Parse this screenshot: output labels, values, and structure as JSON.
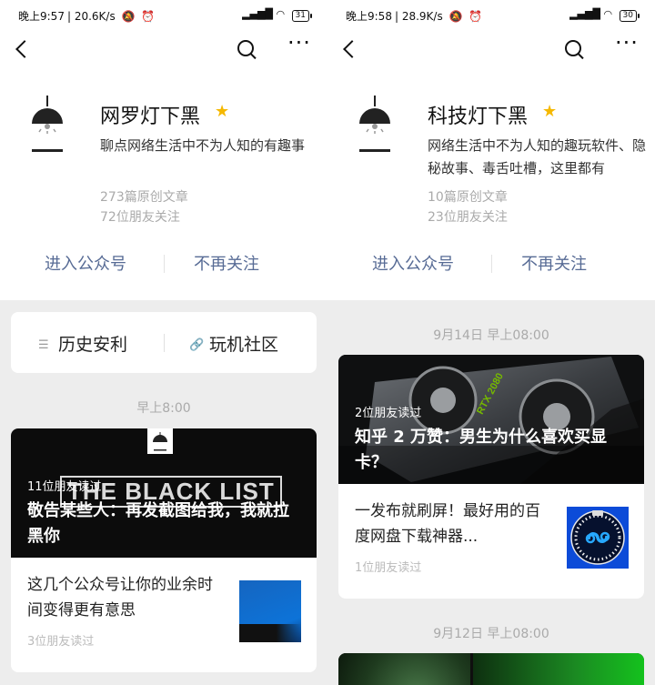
{
  "left": {
    "status": {
      "time": "晚上9:57",
      "speed": "20.6K/s",
      "battery": "31"
    },
    "account": {
      "name": "网罗灯下黑",
      "description": "聊点网络生活中不为人知的有趣事",
      "articles": "273篇原创文章",
      "friends": "72位朋友关注"
    },
    "actions": {
      "enter": "进入公众号",
      "unfollow": "不再关注"
    },
    "menu": {
      "item1": "历史安利",
      "item2": "玩机社区"
    },
    "time_label": "早上8:00",
    "featured": {
      "banner_text": "THE BLACK LIST",
      "reads": "11位朋友读过",
      "title": "敬告某些人：再发截图给我，我就拉黑你"
    },
    "article": {
      "title": "这几个公众号让你的业余时间变得更有意思",
      "reads": "3位朋友读过"
    }
  },
  "right": {
    "status": {
      "time": "晚上9:58",
      "speed": "28.9K/s",
      "battery": "30"
    },
    "account": {
      "name": "科技灯下黑",
      "description": "网络生活中不为人知的趣玩软件、隐秘故事、毒舌吐槽，这里都有",
      "articles": "10篇原创文章",
      "friends": "23位朋友关注"
    },
    "actions": {
      "enter": "进入公众号",
      "unfollow": "不再关注"
    },
    "time_label_1": "9月14日 早上08:00",
    "featured": {
      "banner_text": "RTX 2080",
      "reads": "2位朋友读过",
      "title": "知乎 2 万赞：男生为什么喜欢买显卡？"
    },
    "article": {
      "title": "一发布就刷屏！最好用的百度网盘下载神器...",
      "reads": "1位朋友读过"
    },
    "time_label_2": "9月12日 早上08:00"
  },
  "colors": {
    "link": "#576b95",
    "star": "#f5b800",
    "page_bg": "#ededed"
  }
}
